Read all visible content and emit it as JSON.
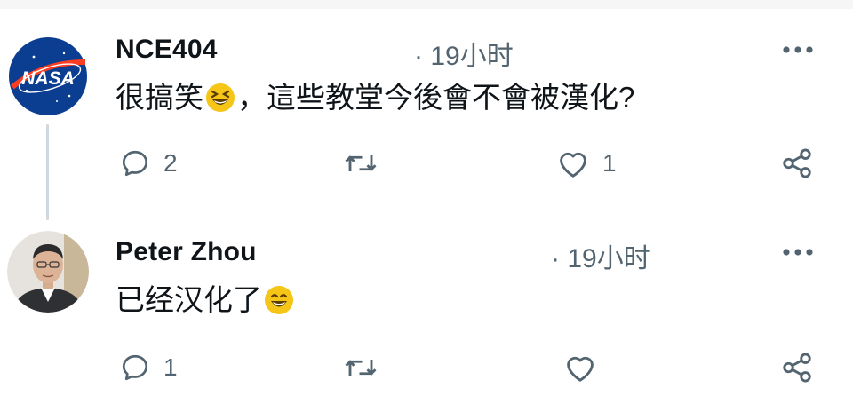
{
  "posts": [
    {
      "username": "NCE404",
      "time": "· 19小时",
      "text_before": "很搞笑",
      "emoji": "grinning-squinting-face-emoji",
      "text_after": "，這些教堂今後會不會被漢化?",
      "avatar_logo_text": "NASA",
      "replies": "2",
      "reposts": "",
      "likes": "1",
      "icons": {
        "reply": "reply-icon",
        "repost": "repost-icon",
        "like": "heart-icon",
        "share": "share-icon",
        "more": "more-icon"
      }
    },
    {
      "username": "Peter Zhou",
      "time": "· 19小时",
      "text_before": "已经汉化了",
      "emoji": "grinning-smiling-face-emoji",
      "text_after": "",
      "replies": "1",
      "reposts": "",
      "likes": "",
      "icons": {
        "reply": "reply-icon",
        "repost": "repost-icon",
        "like": "heart-icon",
        "share": "share-icon",
        "more": "more-icon"
      }
    }
  ],
  "colors": {
    "text": "#0f1419",
    "secondary": "#536471",
    "thread_line": "#cfd9de",
    "emoji_yellow": "#f5c518"
  }
}
